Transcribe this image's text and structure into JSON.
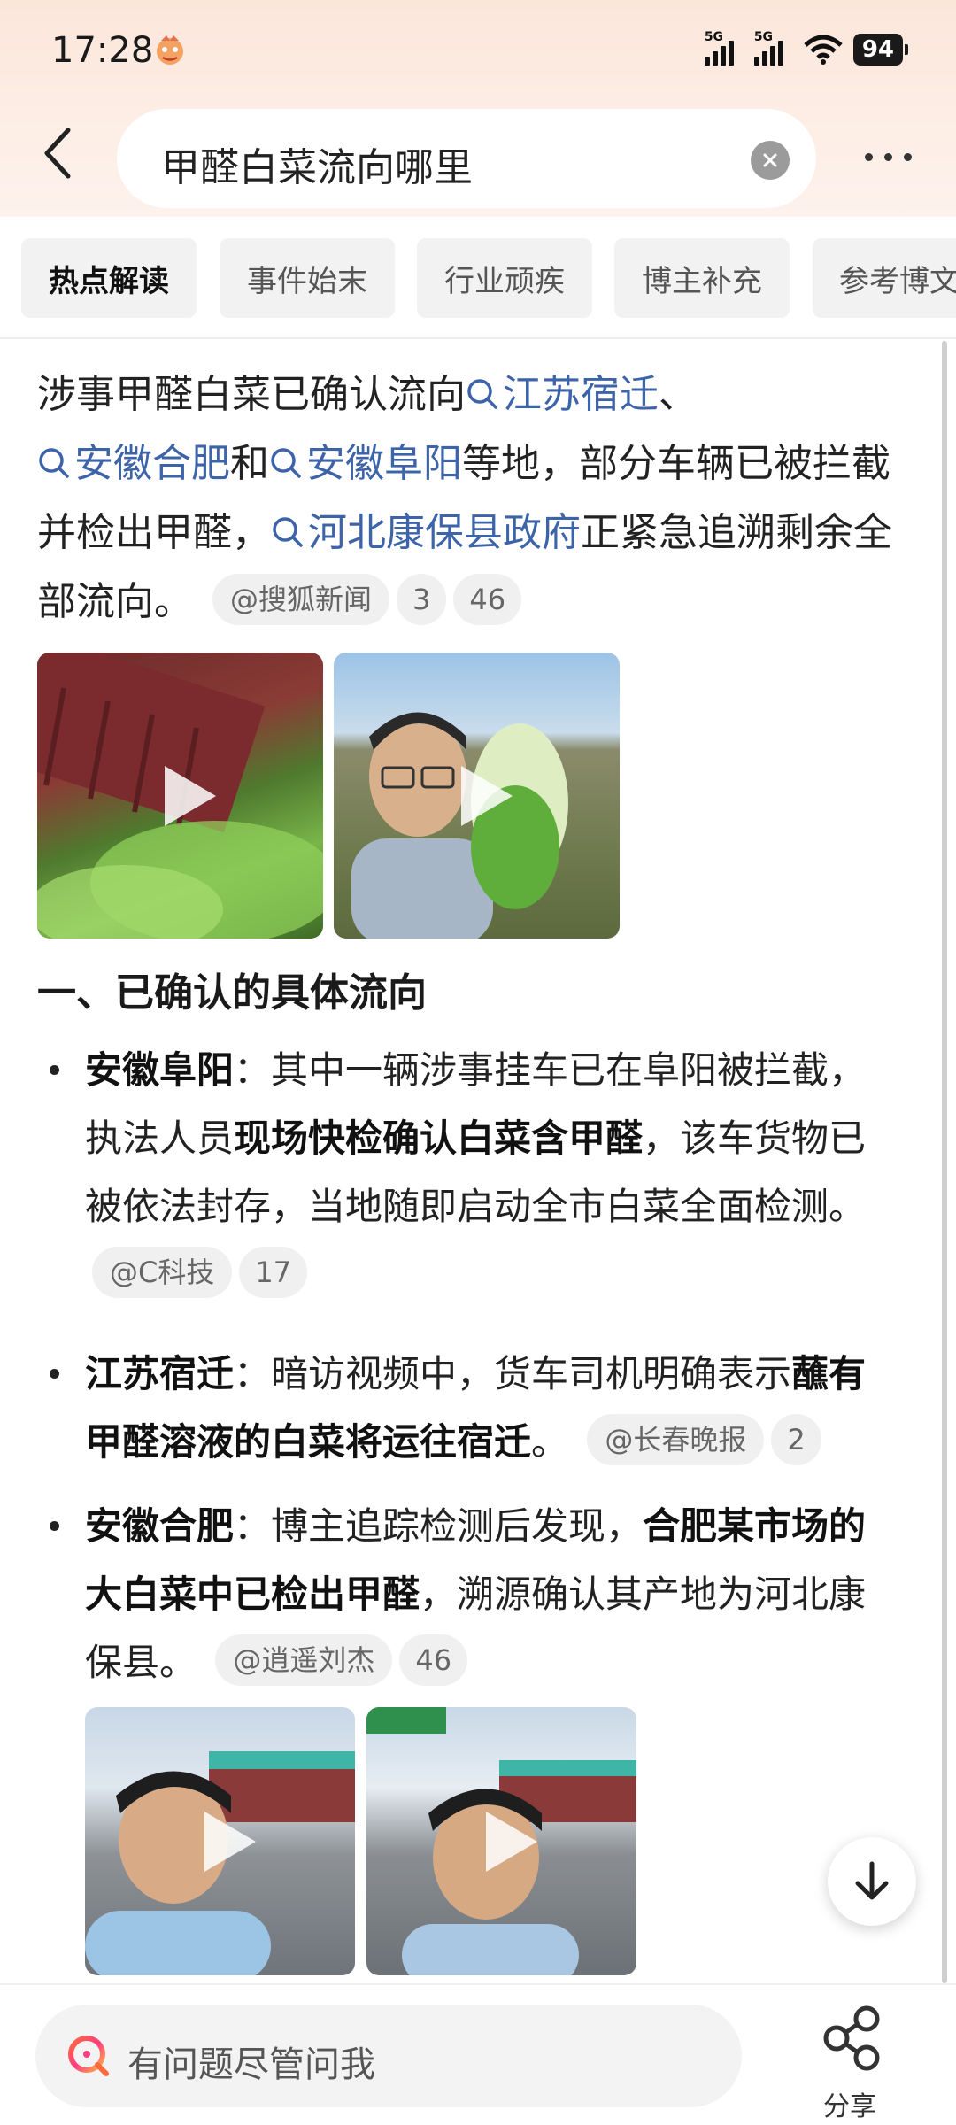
{
  "status_bar": {
    "time": "17:28",
    "battery": "94",
    "signal_label_1": "5G",
    "signal_label_2": "5G"
  },
  "search": {
    "query": "甲醛白菜流向哪里"
  },
  "tabs": [
    {
      "label": "热点解读",
      "active": true
    },
    {
      "label": "事件始末",
      "active": false
    },
    {
      "label": "行业顽疾",
      "active": false
    },
    {
      "label": "博主补充",
      "active": false
    },
    {
      "label": "参考博文",
      "active": false
    }
  ],
  "intro": {
    "t1": "涉事甲醛白菜已确认流向",
    "link1": "江苏宿迁",
    "t2": "、",
    "link2": "安徽合肥",
    "t3": "和",
    "link3": "安徽阜阳",
    "t4": "等地，部分车辆已被拦截并检出甲醛，",
    "link4": "河北康保县政府",
    "t5": "正紧急追溯剩余全部流向。",
    "source": "@搜狐新闻",
    "count1": "3",
    "count2": "46"
  },
  "section1": {
    "title": "一、已确认的具体流向"
  },
  "bullets": [
    {
      "head": "安徽阜阳",
      "t1": "：其中一辆涉事挂车已在阜阳被拦截，执法人员",
      "b1": "现场快检确认白菜含甲醛",
      "t2": "，该车货物已被依法封存，当地随即启动全市白菜全面检测。",
      "source": "@C科技",
      "count": "17"
    },
    {
      "head": "江苏宿迁",
      "t1": "：暗访视频中，货车司机明确表示",
      "b1": "蘸有甲醛溶液的白菜将运往宿迁",
      "t2": "。",
      "source": "@长春晚报",
      "count": "2"
    },
    {
      "head": "安徽合肥",
      "t1": "：博主追踪检测后发现，",
      "b1": "合肥某市场的大白菜中已检出甲醛",
      "t2": "，溯源确认其产地为河北康保县。",
      "source": "@逍遥刘杰",
      "count": "46"
    }
  ],
  "bottom": {
    "ask_placeholder": "有问题尽管问我",
    "share_label": "分享"
  },
  "icons": [
    "back-arrow-icon",
    "clear-icon",
    "more-icon",
    "search-link-icon",
    "play-icon",
    "scroll-down-icon",
    "ai-ask-icon",
    "share-icon"
  ],
  "colors": {
    "link": "#3d63a8",
    "header_bg": "#fbe6da"
  }
}
